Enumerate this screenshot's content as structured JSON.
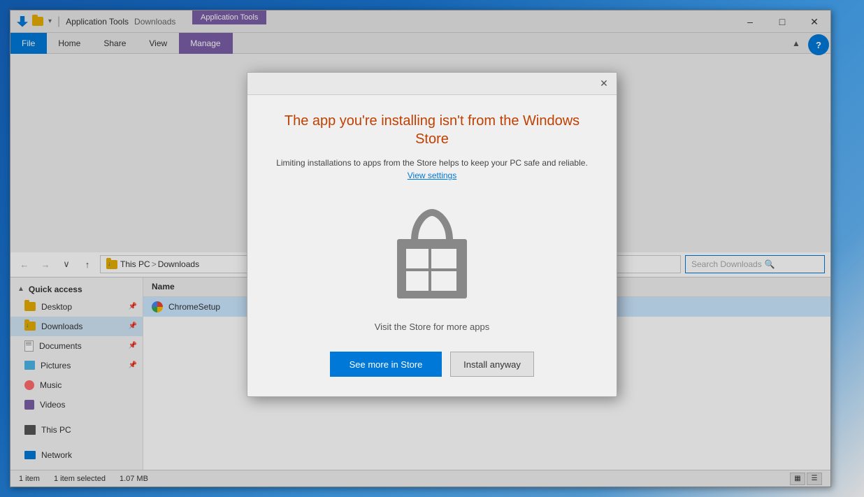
{
  "window": {
    "title": "Downloads",
    "ribbon_app_label": "Application Tools"
  },
  "titlebar": {
    "minimize": "–",
    "maximize": "□",
    "close": "✕"
  },
  "ribbon": {
    "tabs": [
      {
        "label": "File",
        "id": "file",
        "active": true
      },
      {
        "label": "Home",
        "id": "home"
      },
      {
        "label": "Share",
        "id": "share"
      },
      {
        "label": "View",
        "id": "view"
      },
      {
        "label": "Manage",
        "id": "manage"
      }
    ]
  },
  "address": {
    "path_parts": [
      "This PC",
      "Downloads"
    ],
    "search_placeholder": "Search Downloads"
  },
  "sidebar": {
    "quick_access_label": "Quick access",
    "items": [
      {
        "label": "Desktop",
        "type": "folder",
        "pinned": true
      },
      {
        "label": "Downloads",
        "type": "downloads",
        "pinned": true,
        "active": true
      },
      {
        "label": "Documents",
        "type": "doc",
        "pinned": true
      },
      {
        "label": "Pictures",
        "type": "pic",
        "pinned": true
      },
      {
        "label": "Music",
        "type": "music"
      },
      {
        "label": "Videos",
        "type": "video"
      }
    ],
    "this_pc_label": "This PC",
    "network_label": "Network"
  },
  "files": {
    "column_name": "Name",
    "items": [
      {
        "name": "ChromeSetup",
        "type": "chrome"
      }
    ]
  },
  "status": {
    "count": "1 item",
    "selected": "1 item selected",
    "size": "1.07 MB"
  },
  "dialog": {
    "title": "The app you're installing isn't from the Windows Store",
    "subtitle": "Limiting installations to apps from the Store helps to keep your PC safe and reliable.",
    "link_text": "View settings",
    "visit_text": "Visit the Store for more apps",
    "btn_store": "See more in Store",
    "btn_install": "Install anyway",
    "close_char": "✕"
  }
}
